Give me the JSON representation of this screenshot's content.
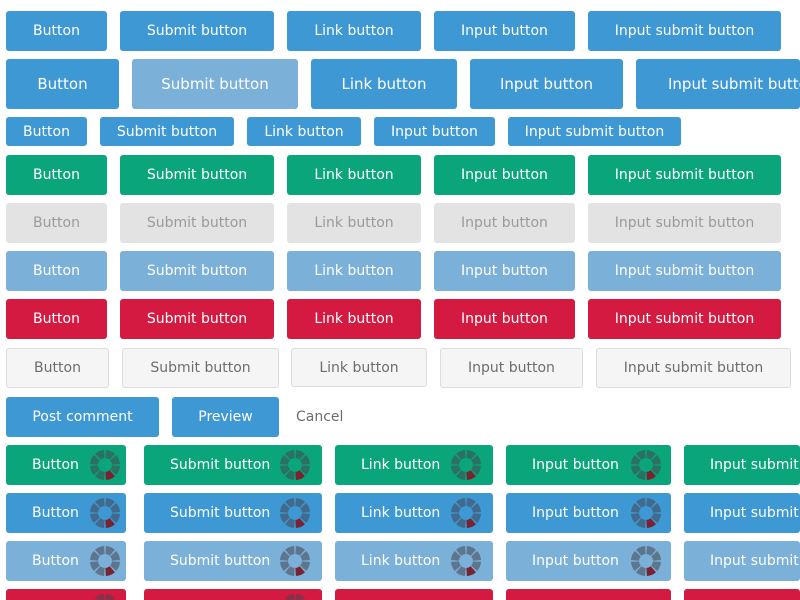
{
  "rows": [
    {
      "name": "blue-default",
      "buttons": [
        "Button",
        "Submit button",
        "Link button",
        "Input button",
        "Input submit button"
      ]
    },
    {
      "name": "blue-large",
      "buttons": [
        "Button",
        "Submit button",
        "Link button",
        "Input button",
        "Input submit button"
      ]
    },
    {
      "name": "blue-small",
      "buttons": [
        "Button",
        "Submit button",
        "Link button",
        "Input button",
        "Input submit button"
      ]
    },
    {
      "name": "green",
      "buttons": [
        "Button",
        "Submit button",
        "Link button",
        "Input button",
        "Input submit button"
      ]
    },
    {
      "name": "disabled",
      "buttons": [
        "Button",
        "Submit button",
        "Link button",
        "Input button",
        "Input submit button"
      ]
    },
    {
      "name": "light-blue",
      "buttons": [
        "Button",
        "Submit button",
        "Link button",
        "Input button",
        "Input submit button"
      ]
    },
    {
      "name": "red",
      "buttons": [
        "Button",
        "Submit button",
        "Link button",
        "Input button",
        "Input submit button"
      ]
    },
    {
      "name": "plain",
      "buttons": [
        "Button",
        "Submit button",
        "Link button",
        "Input button",
        "Input submit button"
      ]
    }
  ],
  "form_actions": {
    "post_comment": "Post comment",
    "preview": "Preview",
    "cancel": "Cancel"
  },
  "loading_rows": [
    {
      "name": "green-loading",
      "buttons": [
        "Button",
        "Submit button",
        "Link button",
        "Input button",
        "Input submit"
      ]
    },
    {
      "name": "blue-loading",
      "buttons": [
        "Button",
        "Submit button",
        "Link button",
        "Input button",
        "Input submit"
      ]
    },
    {
      "name": "light-blue-loading",
      "buttons": [
        "Button",
        "Submit button",
        "Link button",
        "Input button",
        "Input submit"
      ]
    }
  ],
  "colors": {
    "blue": "#3d98d4",
    "light_blue": "#7bb0d8",
    "green": "#0ba57b",
    "disabled": "#e3e3e3",
    "red": "#d41a40",
    "plain": "#f5f5f5",
    "spinner_accent": "#7a2230"
  },
  "icons": {
    "loading": "loading-spinner-icon"
  }
}
